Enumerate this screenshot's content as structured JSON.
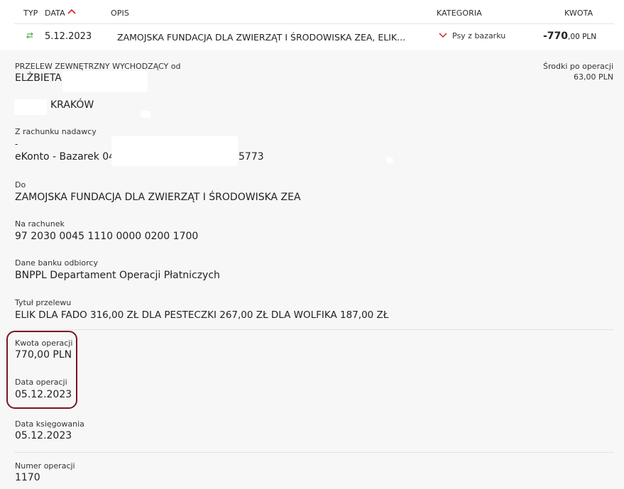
{
  "table": {
    "headers": {
      "type": "TYP",
      "date": "DATA",
      "desc": "OPIS",
      "category": "KATEGORIA",
      "amount": "KWOTA"
    },
    "row": {
      "date": "5.12.2023",
      "description": "ZAMOJSKA FUNDACJA DLA ZWIERZĄT I ŚRODOWISKA ZEA, ELIK...",
      "category": "Psy z bazarku",
      "amount_main": "-770",
      "amount_rest": ",00 PLN"
    }
  },
  "details": {
    "type_label": "PRZELEW ZEWNĘTRZNY WYCHODZĄCY od",
    "sender_name": "ELŻBIETA",
    "sender_city": "KRAKÓW",
    "balance_label": "Środki po operacji",
    "balance_value": "63,00 PLN",
    "from_account_label": "Z rachunku nadawcy",
    "from_account_dash": "-",
    "from_account_name": "eKonto - Bazarek 04",
    "from_account_tail": "5773",
    "to_label": "Do",
    "to_value": "ZAMOJSKA FUNDACJA DLA ZWIERZĄT I ŚRODOWISKA ZEA",
    "account_label": "Na rachunek",
    "account_value": "97 2030 0045 1110 0000 0200 1700",
    "bank_label": "Dane banku odbiorcy",
    "bank_value": "BNPPL Departament Operacji Płatniczych",
    "title_label": "Tytuł przelewu",
    "title_value": "ELIK DLA FADO 316,00 ZŁ DLA PESTECZKI 267,00 ZŁ DLA WOLFIKA 187,00 ZŁ",
    "amount_label": "Kwota operacji",
    "amount_value": "770,00 PLN",
    "op_date_label": "Data operacji",
    "op_date_value": "05.12.2023",
    "booking_label": "Data księgowania",
    "booking_value": "05.12.2023",
    "number_label": "Numer operacji",
    "number_value": "1170"
  },
  "colors": {
    "accent": "#d0202e",
    "highlight": "#7a1522",
    "transfer_icon": "#4caf50"
  }
}
